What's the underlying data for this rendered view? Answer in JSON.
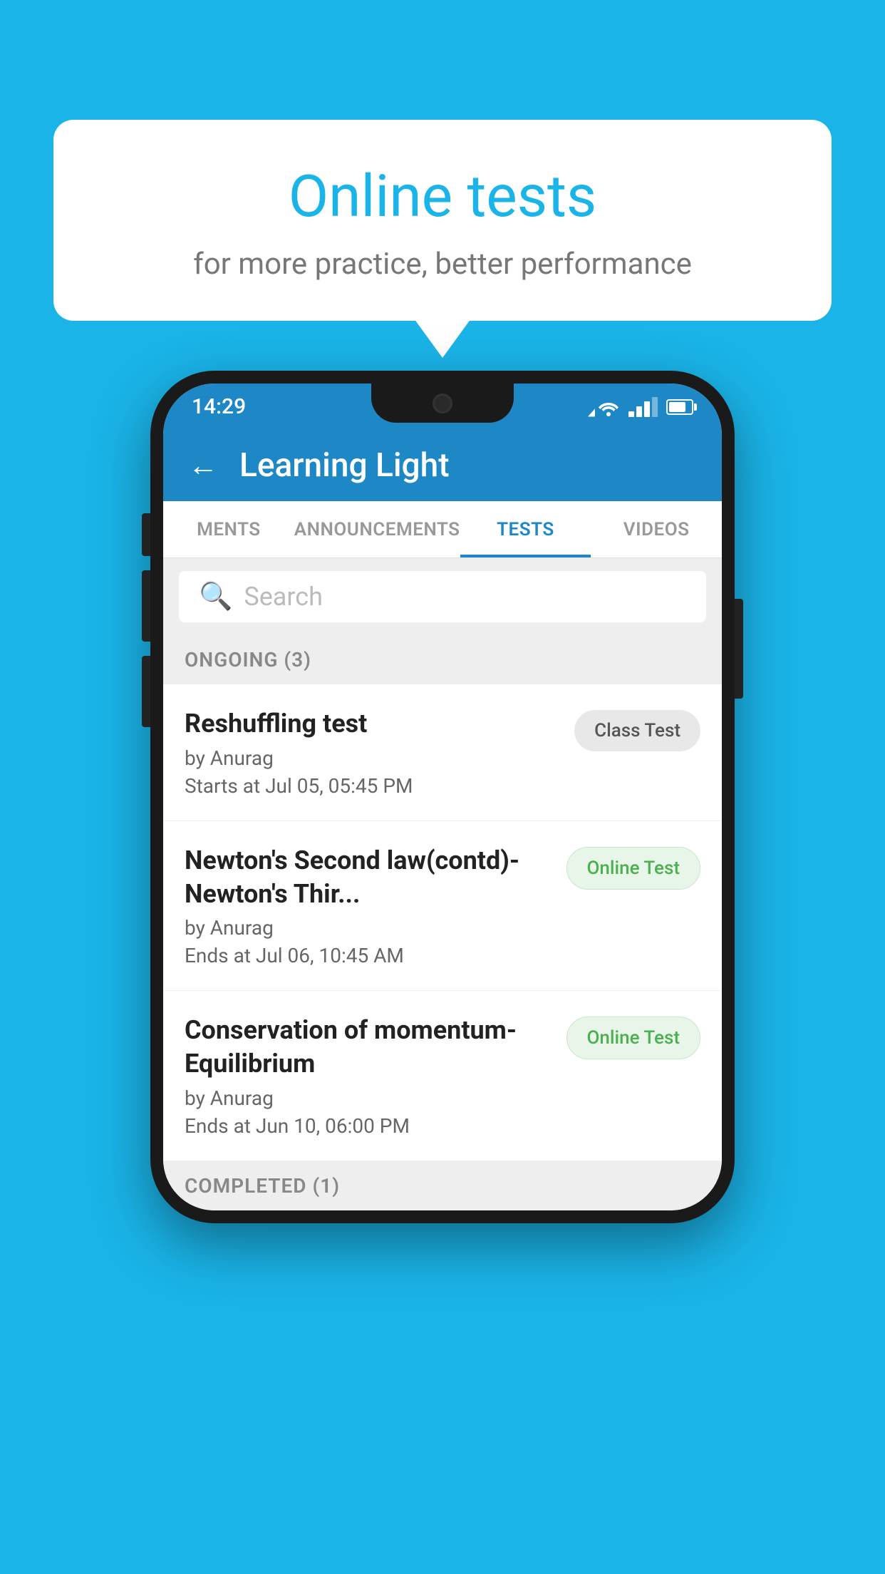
{
  "background": {
    "color": "#1ab4e8"
  },
  "speech_bubble": {
    "title": "Online tests",
    "subtitle": "for more practice, better performance"
  },
  "phone": {
    "status_bar": {
      "time": "14:29"
    },
    "app_header": {
      "title": "Learning Light",
      "back_label": "←"
    },
    "tabs": [
      {
        "label": "MENTS",
        "active": false
      },
      {
        "label": "ANNOUNCEMENTS",
        "active": false
      },
      {
        "label": "TESTS",
        "active": true
      },
      {
        "label": "VIDEOS",
        "active": false
      }
    ],
    "search": {
      "placeholder": "Search"
    },
    "ongoing_section": {
      "label": "ONGOING (3)"
    },
    "tests": [
      {
        "name": "Reshuffling test",
        "author": "by Anurag",
        "date": "Starts at  Jul 05, 05:45 PM",
        "badge": "Class Test",
        "badge_type": "class"
      },
      {
        "name": "Newton's Second law(contd)-Newton's Thir...",
        "author": "by Anurag",
        "date": "Ends at  Jul 06, 10:45 AM",
        "badge": "Online Test",
        "badge_type": "online"
      },
      {
        "name": "Conservation of momentum-Equilibrium",
        "author": "by Anurag",
        "date": "Ends at  Jun 10, 06:00 PM",
        "badge": "Online Test",
        "badge_type": "online"
      }
    ],
    "completed_section": {
      "label": "COMPLETED (1)"
    }
  }
}
